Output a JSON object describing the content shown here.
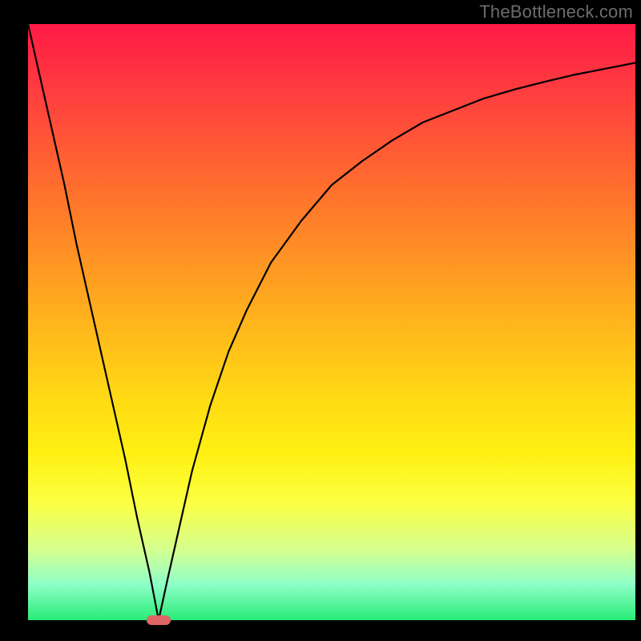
{
  "watermark": "TheBottleneck.com",
  "colors": {
    "gradient_top": "#ff1a46",
    "gradient_bottom": "#28ec76",
    "curve": "#000000",
    "marker": "#e06666",
    "frame": "#000000"
  },
  "chart_data": {
    "type": "line",
    "title": "",
    "xlabel": "",
    "ylabel": "",
    "xlim": [
      0,
      100
    ],
    "ylim": [
      0,
      100
    ],
    "grid": false,
    "series": [
      {
        "name": "curve",
        "x": [
          0,
          2,
          4,
          6,
          8,
          10,
          12,
          14,
          16,
          18,
          20,
          21.5,
          23,
          25,
          27,
          30,
          33,
          36,
          40,
          45,
          50,
          55,
          60,
          65,
          70,
          75,
          80,
          85,
          90,
          95,
          100
        ],
        "y": [
          100,
          91,
          82,
          73,
          63,
          54,
          45,
          36,
          27,
          17,
          8,
          0,
          7,
          16,
          25,
          36,
          45,
          52,
          60,
          67,
          73,
          77,
          80.5,
          83.5,
          85.5,
          87.5,
          89,
          90.3,
          91.5,
          92.5,
          93.5
        ]
      }
    ],
    "annotations": [
      {
        "name": "min-marker",
        "x": 21.5,
        "y": 0
      }
    ]
  }
}
